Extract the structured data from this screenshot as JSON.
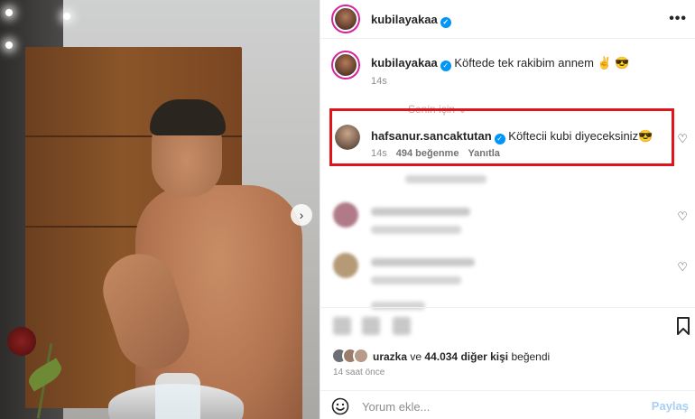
{
  "post": {
    "author": "kubilayakaa",
    "caption": "Köftede tek rakibim annem ✌️ 😎",
    "caption_time": "14s"
  },
  "filter_label": "Senin için ⌄",
  "highlight_comment": {
    "user": "hafsanur.sancaktutan",
    "text": "Köftecii kubi diyeceksiniz😎",
    "time": "14s",
    "likes": "494 beğenme",
    "reply": "Yanıtla"
  },
  "liked_by": {
    "user": "urazka",
    "connector": "ve",
    "count": "44.034 diğer kişi",
    "suffix": "beğendi"
  },
  "posted_time": "14 saat önce",
  "comment_box": {
    "placeholder": "Yorum ekle...",
    "share": "Paylaş"
  },
  "icons": {
    "verified": "verified-badge-icon",
    "more": "more-options-icon",
    "heart": "heart-icon",
    "bookmark": "bookmark-icon",
    "emoji": "emoji-icon",
    "next": "chevron-right-icon"
  },
  "colors": {
    "verified": "#0095f6",
    "highlight": "#e0151b",
    "share": "#a7d0f5"
  }
}
